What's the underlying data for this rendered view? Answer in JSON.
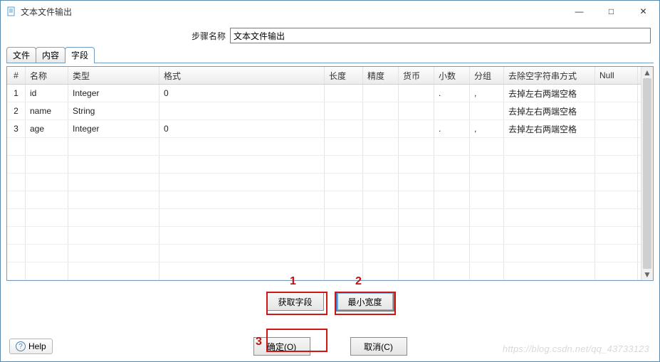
{
  "window": {
    "title": "文本文件输出",
    "minimize": "—",
    "maximize": "□",
    "close": "✕"
  },
  "step": {
    "label": "步骤名称",
    "value": "文本文件输出"
  },
  "tabs": [
    "文件",
    "内容",
    "字段"
  ],
  "active_tab_index": 2,
  "columns": {
    "idx": "#",
    "name": "名称",
    "type": "类型",
    "fmt": "格式",
    "len": "长度",
    "prec": "精度",
    "curr": "货币",
    "dec": "小数",
    "grp": "分组",
    "trim": "去除空字符串方式",
    "null": "Null"
  },
  "rows": [
    {
      "idx": "1",
      "name": "id",
      "type": "Integer",
      "fmt": "0",
      "len": "",
      "prec": "",
      "curr": "",
      "dec": ".",
      "grp": ",",
      "trim": "去掉左右两端空格",
      "null": ""
    },
    {
      "idx": "2",
      "name": "name",
      "type": "String",
      "fmt": "",
      "len": "",
      "prec": "",
      "curr": "",
      "dec": "",
      "grp": "",
      "trim": "去掉左右两端空格",
      "null": ""
    },
    {
      "idx": "3",
      "name": "age",
      "type": "Integer",
      "fmt": "0",
      "len": "",
      "prec": "",
      "curr": "",
      "dec": ".",
      "grp": ",",
      "trim": "去掉左右两端空格",
      "null": ""
    }
  ],
  "buttons": {
    "get_fields": "获取字段",
    "min_width": "最小宽度",
    "ok": "确定(O)",
    "cancel": "取消(C)",
    "help": "Help"
  },
  "annotations": {
    "a1": "1",
    "a2": "2",
    "a3": "3"
  },
  "watermark": "https://blog.csdn.net/qq_43733123"
}
